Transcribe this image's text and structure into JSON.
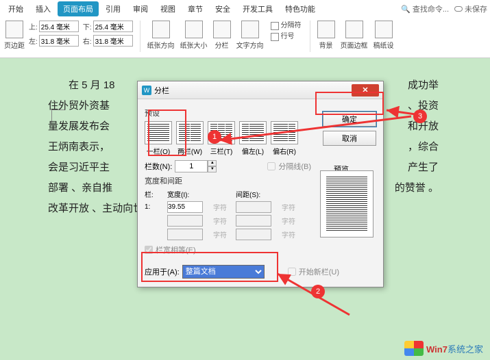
{
  "tabs": {
    "start": "开始",
    "insert": "插入",
    "layout": "页面布局",
    "ref": "引用",
    "review": "审阅",
    "view": "视图",
    "chapter": "章节",
    "security": "安全",
    "dev": "开发工具",
    "feature": "特色功能"
  },
  "ribbon_search": "查找命令...",
  "unsaved": "未保存",
  "margins": {
    "label": "页边距",
    "top": "上:",
    "bottom": "左:",
    "top2": "下:",
    "right": "右:",
    "v1": "25.4 毫米",
    "v2": "31.8 毫米",
    "v3": "25.4 毫米",
    "v4": "31.8 毫米"
  },
  "toolbar": {
    "orient": "纸张方向",
    "size": "纸张大小",
    "columns": "分栏",
    "textdir": "文字方向",
    "sep": "分隔符",
    "linenum": "行号",
    "bg": "背景",
    "border": "页面边框",
    "稿": "稿纸设"
  },
  "dlg": {
    "title": "分栏",
    "preset_label": "预设",
    "presets": [
      "一栏(O)",
      "两栏(W)",
      "三栏(T)",
      "偏左(L)",
      "偏右(R)"
    ],
    "ok": "确定",
    "cancel": "取消",
    "count_label": "栏数(N):",
    "count": "1",
    "wg_label": "宽度和间距",
    "col": "栏:",
    "width": "宽度(I):",
    "spacing": "间距(S):",
    "row1": "1:",
    "w1": "39.55",
    "unit": "字符",
    "dash": "字符",
    "sep_line": "分隔线(B)",
    "preview": "预览",
    "equal": "栏宽相等(E)",
    "apply_label": "应用于(A):",
    "apply_val": "整篇文档",
    "newcol": "开始新栏(U)"
  },
  "doc": {
    "l1": "在 5 月 18",
    "l2": "住外贸外资基",
    "l3": "量发展发布会",
    "l4": "王炳南表示，",
    "l5": "会是习近平主",
    "l6": "部署 、亲自推",
    "l7": "改革开放 、主动向世界开放市场",
    "r1": "成功举",
    "r2": "、投资",
    "r3": "和开放",
    "r4": "，综合",
    "r5": "产生了",
    "r6": "的赞誉 。"
  },
  "watermark": "系统之家"
}
